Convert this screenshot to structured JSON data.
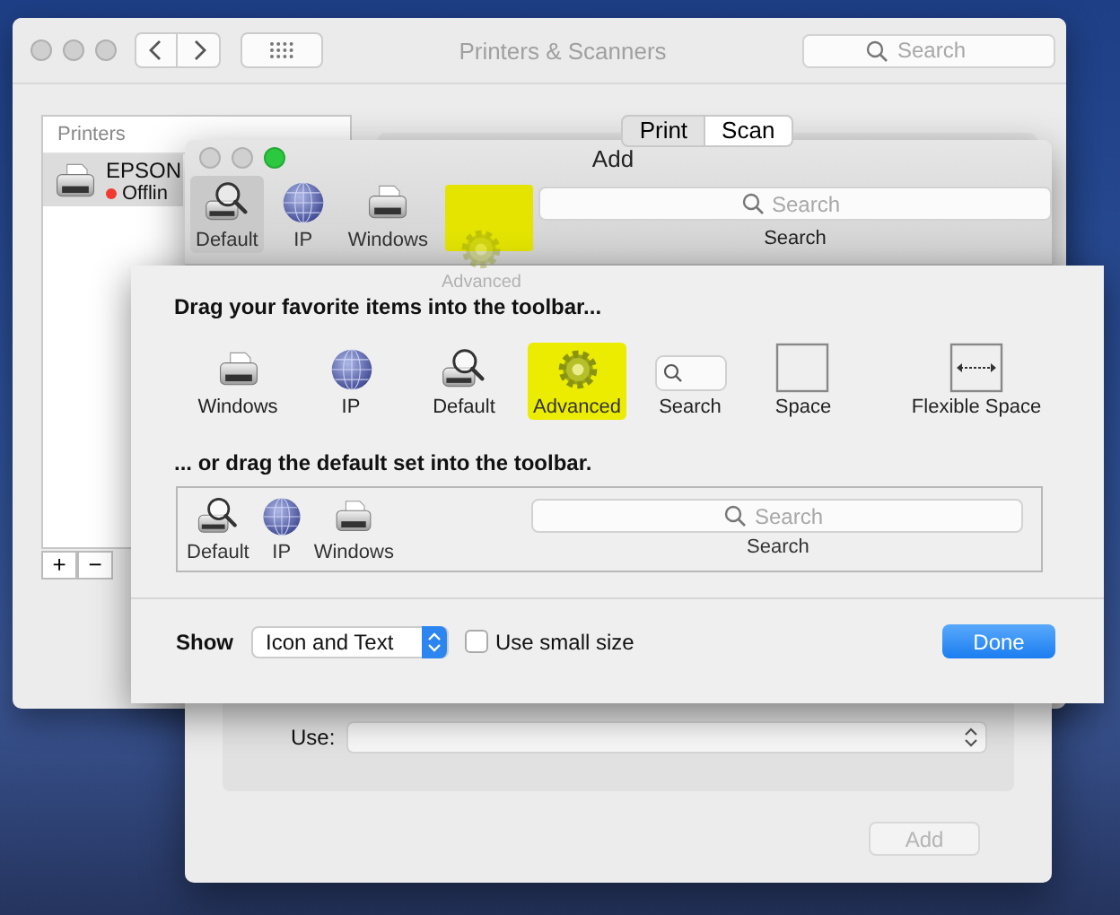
{
  "main_window": {
    "title": "Printers & Scanners",
    "search": {
      "placeholder": "Search"
    },
    "printers": {
      "header": "Printers",
      "items": [
        {
          "name": "EPSON",
          "status": "Offlin",
          "selected": true
        }
      ]
    },
    "list_buttons": [
      "+",
      "−"
    ],
    "segments": [
      {
        "label": "Print",
        "selected": true
      },
      {
        "label": "Scan",
        "selected": false
      }
    ]
  },
  "add_window": {
    "title": "Add",
    "toolbar": [
      {
        "kind": "default",
        "label": "Default",
        "selected": true
      },
      {
        "kind": "ip",
        "label": "IP",
        "selected": false
      },
      {
        "kind": "windows",
        "label": "Windows",
        "selected": false
      }
    ],
    "drop_highlight": true,
    "search": {
      "placeholder": "Search",
      "label": "Search"
    },
    "dragged_item": {
      "kind": "advanced",
      "label": "Advanced"
    },
    "use_label": "Use:",
    "add_button": {
      "label": "Add",
      "disabled": true
    }
  },
  "customize_sheet": {
    "heading": "Drag your favorite items into the toolbar...",
    "items": [
      {
        "kind": "windows",
        "label": "Windows",
        "highlighted": false
      },
      {
        "kind": "ip",
        "label": "IP",
        "highlighted": false
      },
      {
        "kind": "default",
        "label": "Default",
        "highlighted": false
      },
      {
        "kind": "advanced",
        "label": "Advanced",
        "highlighted": true
      },
      {
        "kind": "search",
        "label": "Search",
        "highlighted": false
      },
      {
        "kind": "space",
        "label": "Space",
        "highlighted": false
      },
      {
        "kind": "flexible_space",
        "label": "Flexible Space",
        "highlighted": false
      }
    ],
    "default_heading": "... or drag the default set into the toolbar.",
    "default_set": [
      {
        "kind": "default",
        "label": "Default"
      },
      {
        "kind": "ip",
        "label": "IP"
      },
      {
        "kind": "windows",
        "label": "Windows"
      }
    ],
    "default_search": {
      "placeholder": "Search",
      "label": "Search"
    },
    "show_label": "Show",
    "show_popup": "Icon and Text",
    "small_size": {
      "label": "Use small size",
      "checked": false
    },
    "done_button": "Done"
  }
}
